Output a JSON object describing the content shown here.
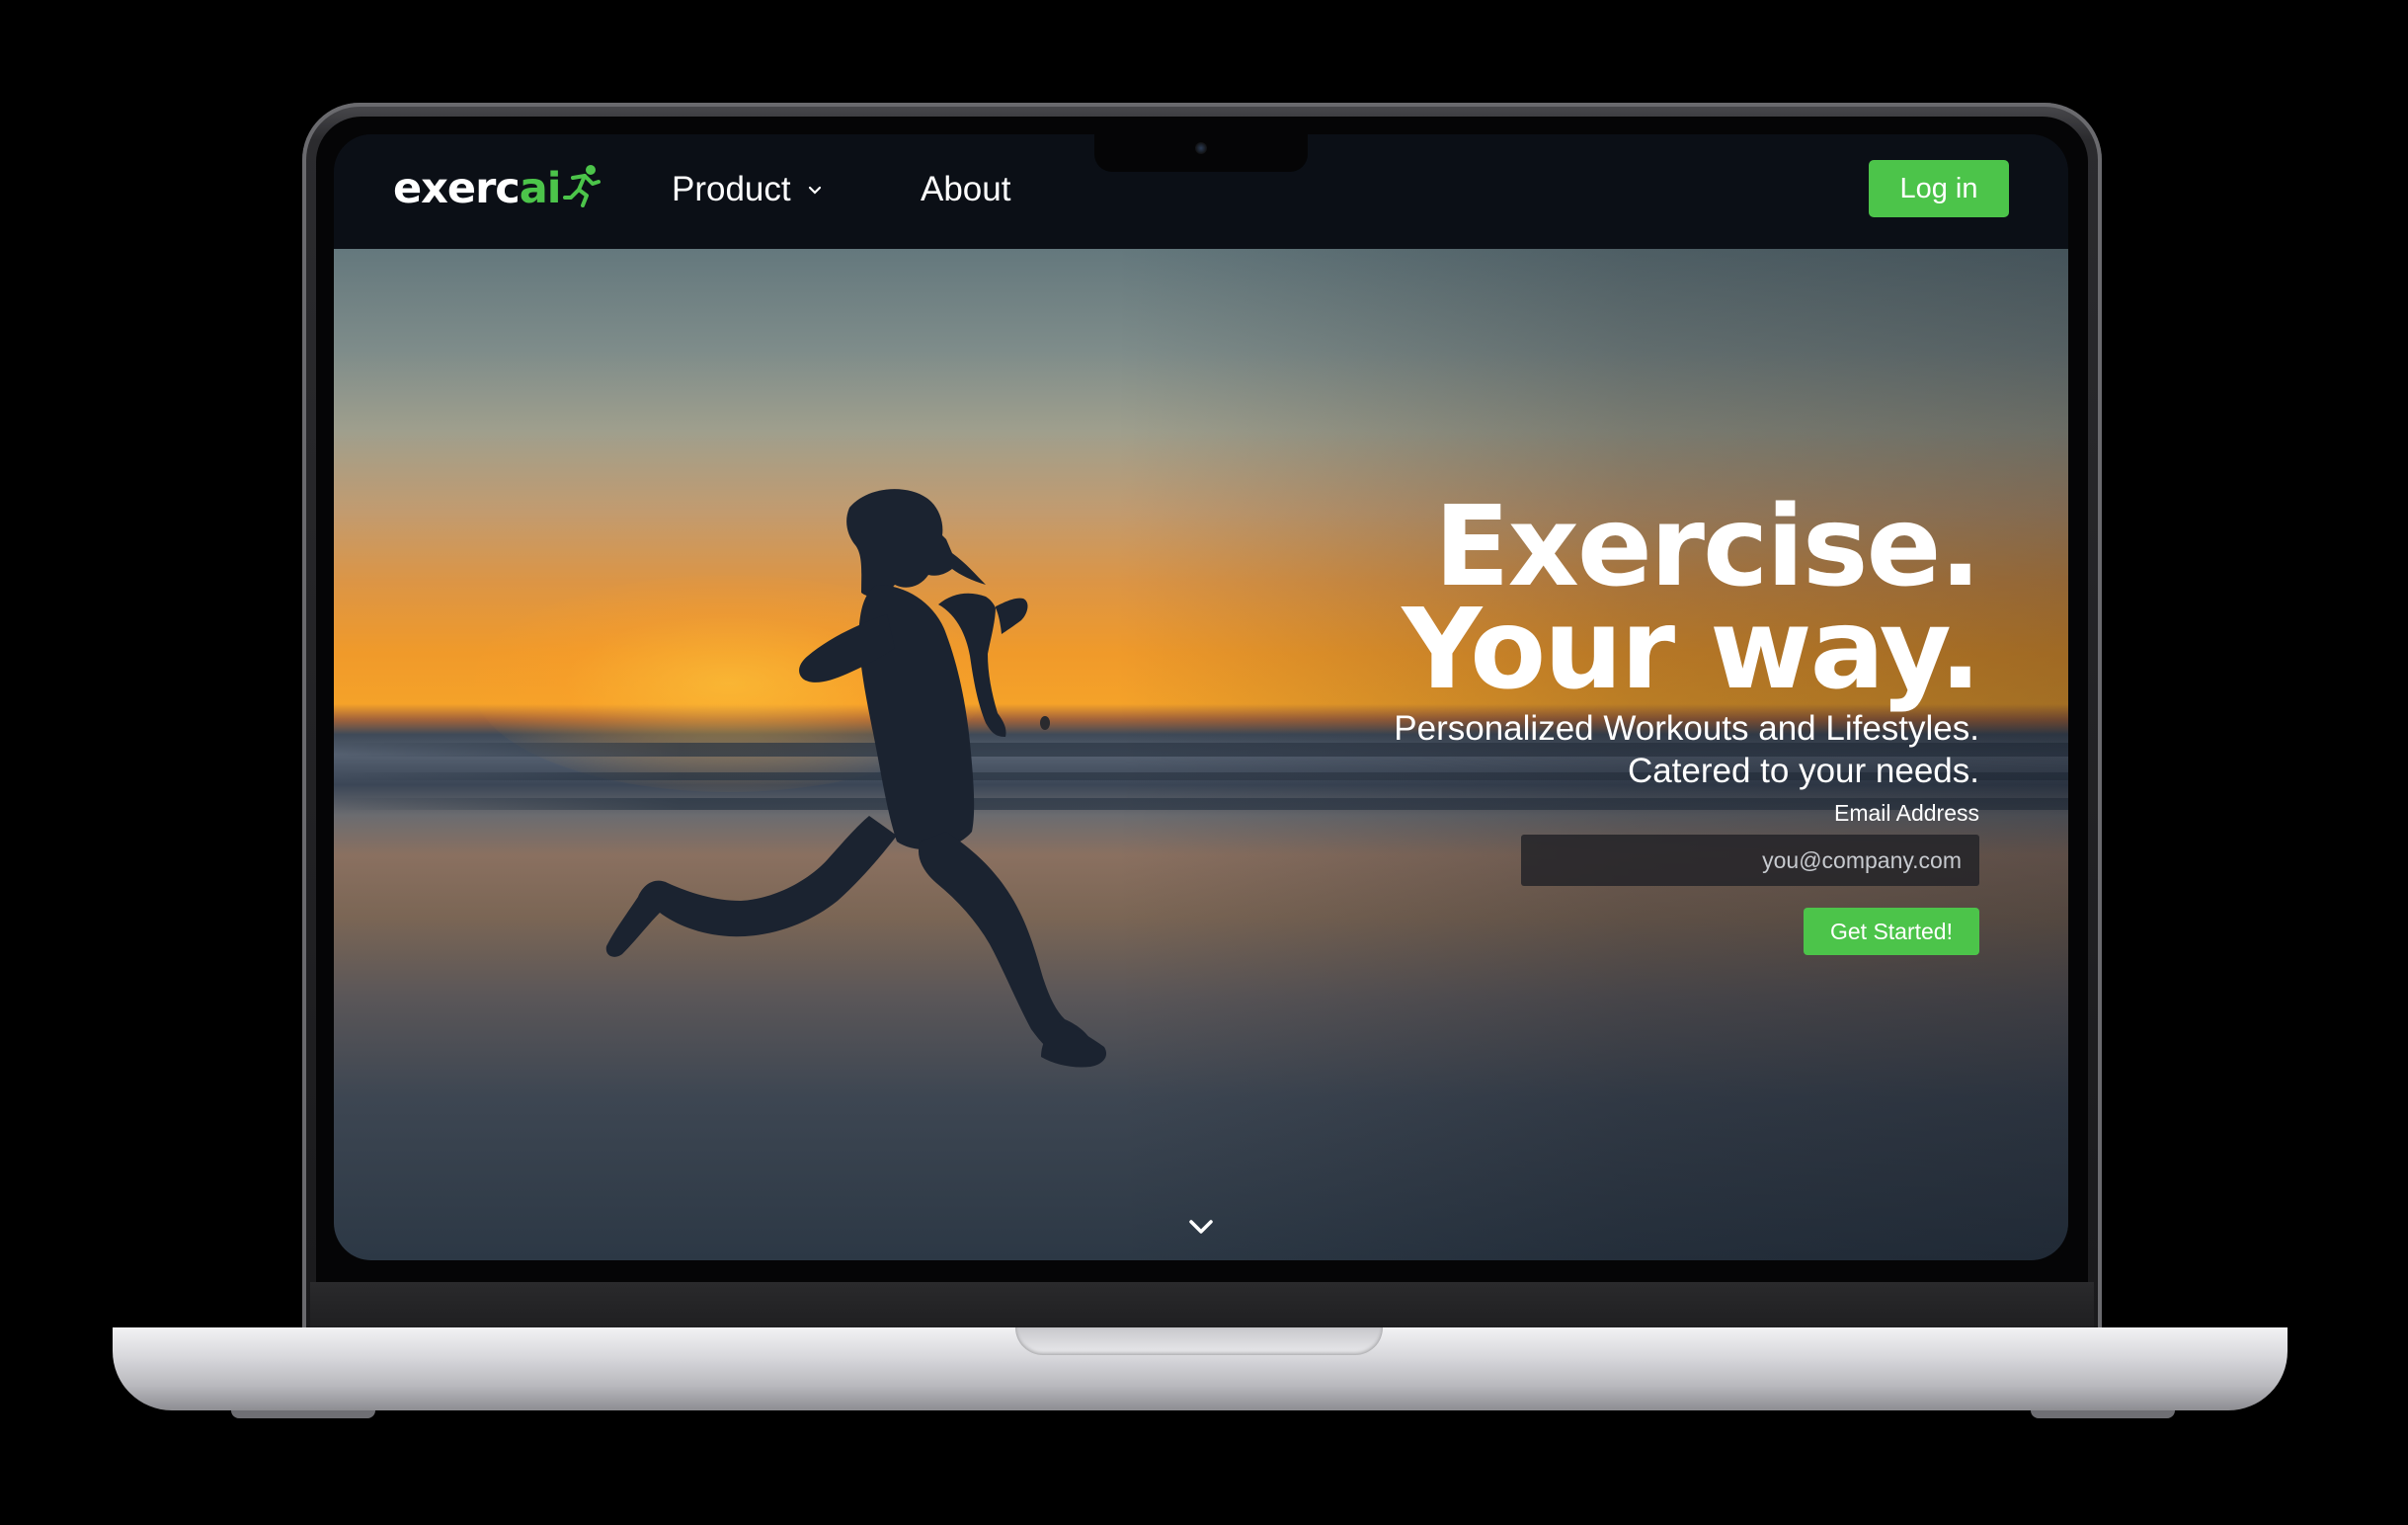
{
  "brand": {
    "logo_main": "exerc",
    "logo_accent": "ai",
    "accent_color": "#4cc44a",
    "logo_icon": "running-person-icon"
  },
  "nav": {
    "items": [
      {
        "label": "Product",
        "has_dropdown": true
      },
      {
        "label": "About",
        "has_dropdown": false
      }
    ],
    "login_label": "Log in"
  },
  "hero": {
    "headline_line1": "Exercise.",
    "headline_line2": "Your way.",
    "subline_line1": "Personalized Workouts and Lifestyles.",
    "subline_line2": "Catered to your needs.",
    "email_label": "Email Address",
    "email_placeholder": "you@company.com",
    "email_value": "",
    "cta_label": "Get Started!",
    "scroll_icon": "chevron-down-icon",
    "background_image": "silhouette of woman running on beach at sunset"
  },
  "colors": {
    "nav_background": "#0b0f16",
    "button_green": "#4cc44a",
    "text": "#ffffff"
  }
}
